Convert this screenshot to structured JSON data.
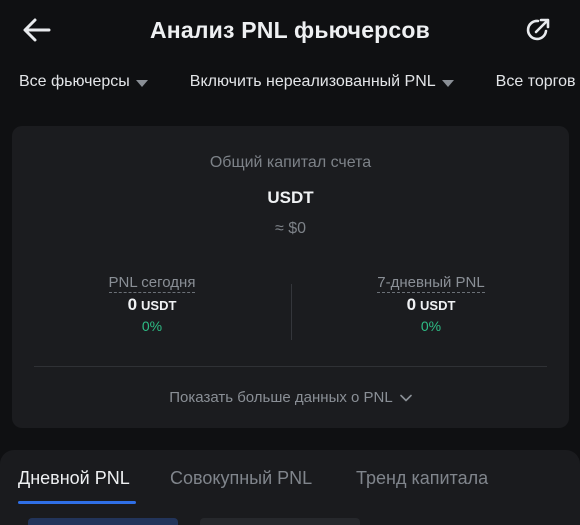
{
  "header": {
    "title": "Анализ PNL фьючерсов",
    "back_icon": "arrow-left-icon",
    "share_icon": "share-icon"
  },
  "filters": [
    {
      "label": "Все фьючерсы"
    },
    {
      "label": "Включить нереализованный PNL"
    },
    {
      "label": "Все торгов"
    }
  ],
  "summary": {
    "capital_label": "Общий капитал счета",
    "capital_currency": "USDT",
    "capital_usd": "≈ $0",
    "pnl_today": {
      "label": "PNL сегодня",
      "value": "0",
      "unit": "USDT",
      "percent": "0%"
    },
    "pnl_7d": {
      "label": "7-дневный PNL",
      "value": "0",
      "unit": "USDT",
      "percent": "0%"
    },
    "show_more_label": "Показать больше данных о PNL"
  },
  "tabs": [
    {
      "label": "Дневной PNL",
      "active": true
    },
    {
      "label": "Совокупный PNL",
      "active": false
    },
    {
      "label": "Тренд капитала",
      "active": false
    }
  ],
  "colors": {
    "background": "#0f1012",
    "card": "#1b1c1f",
    "positive": "#2ebd85",
    "accent": "#2f6fe6"
  }
}
